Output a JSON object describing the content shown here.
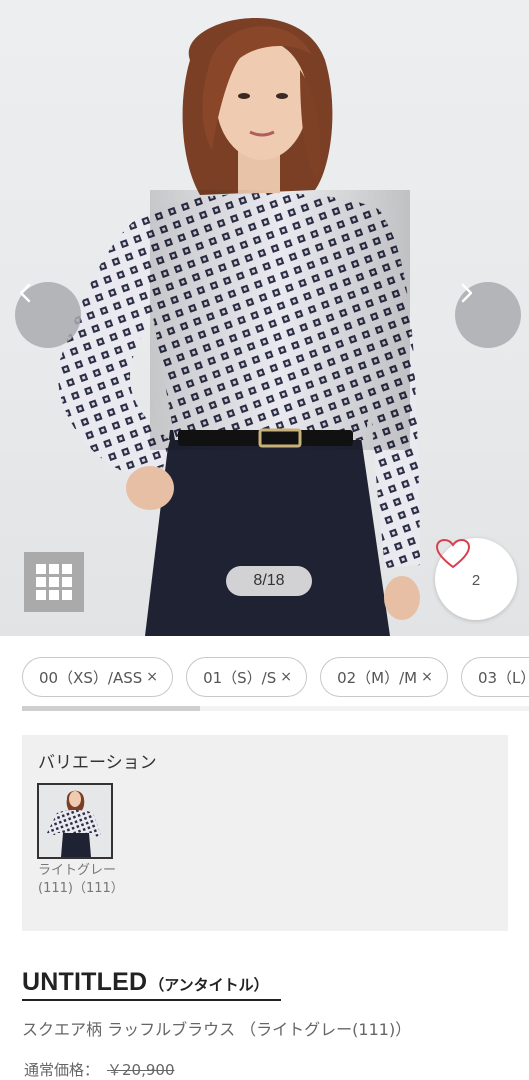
{
  "gallery": {
    "counter": "8/18",
    "favorite_count": "2",
    "icons": {
      "prev": "chevron-left-icon",
      "next": "chevron-right-icon",
      "grid": "grid-icon",
      "favorite": "heart-icon"
    }
  },
  "sizes": [
    {
      "label": "00（XS）/ASS",
      "close": "×"
    },
    {
      "label": "01（S）/S",
      "close": "×"
    },
    {
      "label": "02（M）/M",
      "close": "×"
    },
    {
      "label": "03（L）",
      "close": ""
    }
  ],
  "variation": {
    "title": "バリエーション",
    "items": [
      {
        "label": "ライトグレー(111)（111）"
      }
    ]
  },
  "product": {
    "brand": "UNTITLED",
    "brand_sub": "（アンタイトル）",
    "name": "スクエア柄 ラッフルブラウス （ライトグレー(111)）",
    "price_label": "通常価格：",
    "price": "￥20,900"
  },
  "colors": {
    "accent_heart": "#d8404e",
    "chip_border": "#c8c8c8",
    "variation_bg": "#f0f0f0"
  }
}
